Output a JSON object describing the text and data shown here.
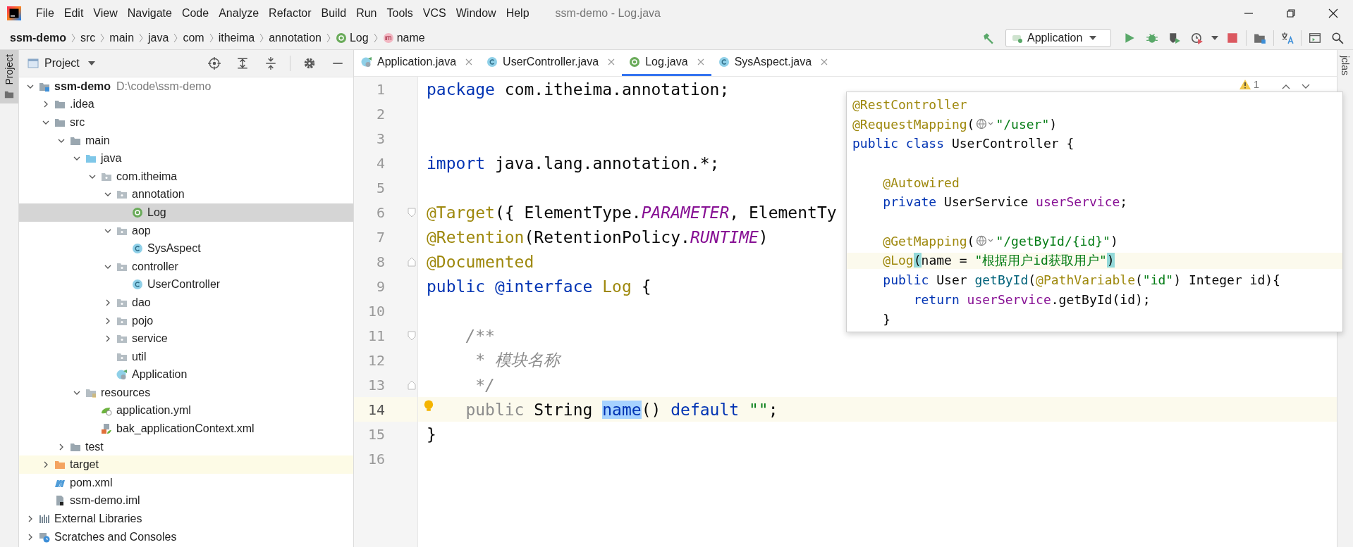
{
  "window_title": "ssm-demo - Log.java",
  "menu": [
    "File",
    "Edit",
    "View",
    "Navigate",
    "Code",
    "Analyze",
    "Refactor",
    "Build",
    "Run",
    "Tools",
    "VCS",
    "Window",
    "Help"
  ],
  "breadcrumbs": [
    {
      "label": "ssm-demo",
      "kind": "project"
    },
    {
      "label": "src",
      "kind": "text"
    },
    {
      "label": "main",
      "kind": "text"
    },
    {
      "label": "java",
      "kind": "text"
    },
    {
      "label": "com",
      "kind": "text"
    },
    {
      "label": "itheima",
      "kind": "text"
    },
    {
      "label": "annotation",
      "kind": "text"
    },
    {
      "label": "Log",
      "kind": "annotation"
    },
    {
      "label": "name",
      "kind": "method"
    }
  ],
  "run_config": "Application",
  "left_strip_label": "Project",
  "right_strip_label": "jclas",
  "project_panel": {
    "title": "Project",
    "tree": [
      {
        "label": "ssm-demo",
        "path": "D:\\code\\ssm-demo",
        "kind": "module",
        "expanded": true,
        "selected": false,
        "children": [
          {
            "label": ".idea",
            "kind": "folder",
            "expanded": false,
            "selected": false
          },
          {
            "label": "src",
            "kind": "folder",
            "expanded": true,
            "selected": false,
            "children": [
              {
                "label": "main",
                "kind": "folder",
                "expanded": true,
                "selected": false,
                "children": [
                  {
                    "label": "java",
                    "kind": "source",
                    "expanded": true,
                    "selected": false,
                    "children": [
                      {
                        "label": "com.itheima",
                        "kind": "package",
                        "expanded": true,
                        "selected": false,
                        "children": [
                          {
                            "label": "annotation",
                            "kind": "package",
                            "expanded": true,
                            "selected": false,
                            "children": [
                              {
                                "label": "Log",
                                "kind": "annotation",
                                "selected": true
                              }
                            ]
                          },
                          {
                            "label": "aop",
                            "kind": "package",
                            "expanded": true,
                            "selected": false,
                            "children": [
                              {
                                "label": "SysAspect",
                                "kind": "class",
                                "selected": false
                              }
                            ]
                          },
                          {
                            "label": "controller",
                            "kind": "package",
                            "expanded": true,
                            "selected": false,
                            "children": [
                              {
                                "label": "UserController",
                                "kind": "class",
                                "selected": false
                              }
                            ]
                          },
                          {
                            "label": "dao",
                            "kind": "package",
                            "expanded": false,
                            "selected": false
                          },
                          {
                            "label": "pojo",
                            "kind": "package",
                            "expanded": false,
                            "selected": false
                          },
                          {
                            "label": "service",
                            "kind": "package",
                            "expanded": false,
                            "selected": false
                          },
                          {
                            "label": "util",
                            "kind": "package",
                            "selected": false
                          },
                          {
                            "label": "Application",
                            "kind": "app",
                            "selected": false
                          }
                        ]
                      }
                    ]
                  },
                  {
                    "label": "resources",
                    "kind": "resources",
                    "expanded": true,
                    "selected": false,
                    "children": [
                      {
                        "label": "application.yml",
                        "kind": "yml",
                        "selected": false
                      },
                      {
                        "label": "bak_applicationContext.xml",
                        "kind": "xml",
                        "selected": false
                      }
                    ]
                  }
                ]
              },
              {
                "label": "test",
                "kind": "folder",
                "expanded": false,
                "selected": false
              }
            ]
          },
          {
            "label": "target",
            "kind": "excluded",
            "expanded": false,
            "selected": false
          },
          {
            "label": "pom.xml",
            "kind": "maven",
            "selected": false
          },
          {
            "label": "ssm-demo.iml",
            "kind": "iml",
            "selected": false
          }
        ]
      },
      {
        "label": "External Libraries",
        "kind": "libraries",
        "expanded": false,
        "selected": false
      },
      {
        "label": "Scratches and Consoles",
        "kind": "scratches",
        "expanded": false,
        "selected": false
      }
    ]
  },
  "tabs": [
    {
      "label": "Application.java",
      "kind": "app",
      "selected": false
    },
    {
      "label": "UserController.java",
      "kind": "class",
      "selected": false
    },
    {
      "label": "Log.java",
      "kind": "annotation",
      "selected": true
    },
    {
      "label": "SysAspect.java",
      "kind": "class",
      "selected": false
    }
  ],
  "editor": {
    "warnings": "1",
    "lines": [
      {
        "number": "1",
        "current": false,
        "tokens": [
          {
            "text": "package",
            "kind": "kw"
          },
          {
            "text": " com.itheima.annotation;",
            "kind": "plain"
          }
        ]
      },
      {
        "number": "2",
        "current": false
      },
      {
        "number": "3",
        "current": false
      },
      {
        "number": "4",
        "current": false,
        "tokens": [
          {
            "text": "import",
            "kind": "kw"
          },
          {
            "text": " java.lang.annotation.*;",
            "kind": "plain"
          }
        ]
      },
      {
        "number": "5",
        "current": false
      },
      {
        "number": "6",
        "current": false,
        "kind": "fold-start",
        "tokens": [
          {
            "text": "@Target",
            "kind": "ann"
          },
          {
            "text": "({ ElementType.",
            "kind": "plain"
          },
          {
            "text": "PARAMETER",
            "kind": "const"
          },
          {
            "text": ", ElementTy",
            "kind": "plain"
          }
        ]
      },
      {
        "number": "7",
        "current": false,
        "tokens": [
          {
            "text": "@Retention",
            "kind": "ann"
          },
          {
            "text": "(RetentionPolicy.",
            "kind": "plain"
          },
          {
            "text": "RUNTIME",
            "kind": "const"
          },
          {
            "text": ")",
            "kind": "plain"
          }
        ]
      },
      {
        "number": "8",
        "current": false,
        "kind": "fold-end",
        "tokens": [
          {
            "text": "@Documented",
            "kind": "ann"
          }
        ]
      },
      {
        "number": "9",
        "current": false,
        "tokens": [
          {
            "text": "public @interface",
            "kind": "kw"
          },
          {
            "text": " Log",
            "kind": "ann"
          },
          {
            "text": " {",
            "kind": "plain"
          }
        ]
      },
      {
        "number": "10",
        "current": false
      },
      {
        "number": "11",
        "current": false,
        "kind": "fold-start",
        "tokens": [
          {
            "text": "    /**",
            "kind": "comment"
          }
        ]
      },
      {
        "number": "12",
        "current": false,
        "tokens": [
          {
            "text": "     * 模块名称",
            "kind": "comment"
          }
        ]
      },
      {
        "number": "13",
        "current": false,
        "kind": "fold-end",
        "tokens": [
          {
            "text": "     */",
            "kind": "comment"
          }
        ]
      },
      {
        "number": "14",
        "current": true,
        "tokens": [
          {
            "text": "    public",
            "kind": "dim"
          },
          {
            "text": " String ",
            "kind": "plain"
          },
          {
            "text": "name",
            "kind": "sel"
          },
          {
            "text": "()",
            "kind": "plain"
          },
          {
            "text": " default",
            "kind": "kw"
          },
          {
            "text": " \"\"",
            "kind": "str"
          },
          {
            "text": ";",
            "kind": "plain"
          }
        ]
      },
      {
        "number": "15",
        "current": false,
        "tokens": [
          {
            "text": "}",
            "kind": "plain"
          }
        ]
      },
      {
        "number": "16",
        "current": false
      }
    ]
  },
  "popup": {
    "lines": [
      {
        "current": false,
        "tokens": [
          {
            "text": "@RestController",
            "kind": "ann"
          }
        ]
      },
      {
        "current": false,
        "tokens": [
          {
            "text": "@RequestMapping",
            "kind": "ann"
          },
          {
            "text": "(",
            "kind": "plain"
          },
          {
            "kind": "globe"
          },
          {
            "text": "\"/user\"",
            "kind": "str"
          },
          {
            "text": ")",
            "kind": "plain"
          }
        ]
      },
      {
        "current": false,
        "tokens": [
          {
            "text": "public class",
            "kind": "kw"
          },
          {
            "text": " UserController {",
            "kind": "plain"
          }
        ]
      },
      {
        "current": false
      },
      {
        "current": false,
        "tokens": [
          {
            "text": "    @Autowired",
            "kind": "ann"
          }
        ]
      },
      {
        "current": false,
        "tokens": [
          {
            "text": "    private",
            "kind": "kw"
          },
          {
            "text": " UserService ",
            "kind": "plain"
          },
          {
            "text": "userService",
            "kind": "field"
          },
          {
            "text": ";",
            "kind": "plain"
          }
        ]
      },
      {
        "current": false
      },
      {
        "current": false,
        "tokens": [
          {
            "text": "    @GetMapping",
            "kind": "ann"
          },
          {
            "text": "(",
            "kind": "plain"
          },
          {
            "kind": "globe"
          },
          {
            "text": "\"/getById/{id}\"",
            "kind": "str"
          },
          {
            "text": ")",
            "kind": "plain"
          }
        ]
      },
      {
        "current": true,
        "tokens": [
          {
            "text": "    @Log",
            "kind": "ann"
          },
          {
            "text": "(",
            "kind": "brace"
          },
          {
            "text": "name = ",
            "kind": "plain"
          },
          {
            "text": "\"根据用户id获取用户\"",
            "kind": "str"
          },
          {
            "text": ")",
            "kind": "brace"
          }
        ]
      },
      {
        "current": false,
        "tokens": [
          {
            "text": "    public",
            "kind": "kw"
          },
          {
            "text": " User ",
            "kind": "plain"
          },
          {
            "text": "getById",
            "kind": "method"
          },
          {
            "text": "(",
            "kind": "plain"
          },
          {
            "text": "@PathVariable",
            "kind": "ann"
          },
          {
            "text": "(",
            "kind": "plain"
          },
          {
            "text": "\"id\"",
            "kind": "str"
          },
          {
            "text": ") Integer id){",
            "kind": "plain"
          }
        ]
      },
      {
        "current": false,
        "tokens": [
          {
            "text": "        return",
            "kind": "kw"
          },
          {
            "text": " userService",
            "kind": "field"
          },
          {
            "text": ".getById(id);",
            "kind": "plain"
          }
        ]
      },
      {
        "current": false,
        "tokens": [
          {
            "text": "    }",
            "kind": "plain"
          }
        ]
      }
    ]
  }
}
